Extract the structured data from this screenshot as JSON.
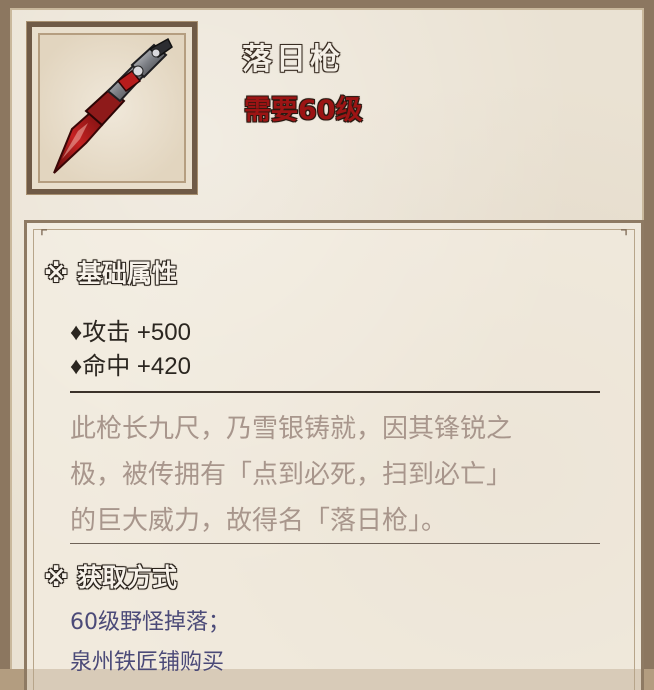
{
  "item": {
    "name": "落日枪",
    "requirement": "需要60级",
    "icon": "spear-icon"
  },
  "basic_attributes": {
    "title": "※ 基础属性",
    "stats": [
      {
        "label": "♦攻击 +500"
      },
      {
        "label": "♦命中 +420"
      }
    ]
  },
  "description": {
    "lines": [
      "此枪长九尺，乃雪银铸就，因其锋锐之",
      "极，被传拥有「点到必死，扫到必亡」",
      "的巨大威力，故得名「落日枪」。"
    ]
  },
  "acquisition": {
    "title": "※ 获取方式",
    "methods": [
      "60级野怪掉落；",
      "泉州铁匠铺购买"
    ]
  },
  "colors": {
    "requirement": "#9c1414",
    "description": "#a8968c",
    "acquisition": "#4b4a78",
    "frame": "#8c7760"
  }
}
